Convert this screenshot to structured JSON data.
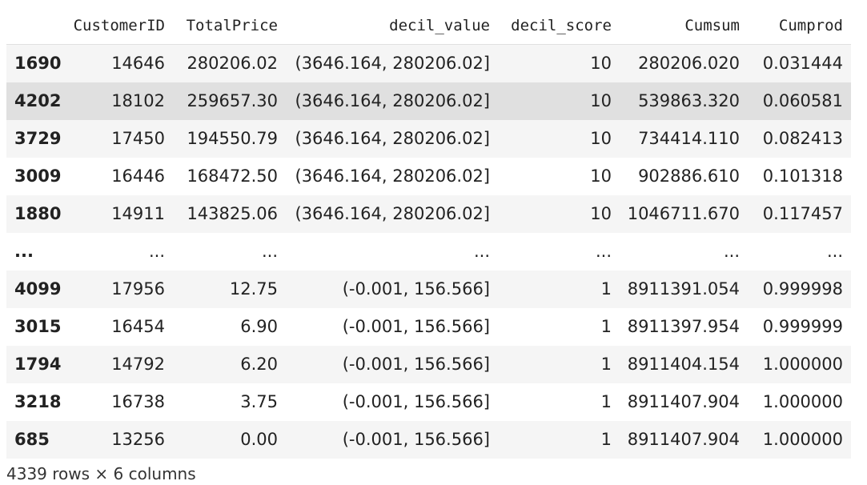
{
  "table": {
    "columns": [
      "CustomerID",
      "TotalPrice",
      "decil_value",
      "decil_score",
      "Cumsum",
      "Cumprod"
    ],
    "rows": [
      {
        "index": "1690",
        "cells": [
          "14646",
          "280206.02",
          "(3646.164, 280206.02]",
          "10",
          "280206.020",
          "0.031444"
        ]
      },
      {
        "index": "4202",
        "cells": [
          "18102",
          "259657.30",
          "(3646.164, 280206.02]",
          "10",
          "539863.320",
          "0.060581"
        ]
      },
      {
        "index": "3729",
        "cells": [
          "17450",
          "194550.79",
          "(3646.164, 280206.02]",
          "10",
          "734414.110",
          "0.082413"
        ]
      },
      {
        "index": "3009",
        "cells": [
          "16446",
          "168472.50",
          "(3646.164, 280206.02]",
          "10",
          "902886.610",
          "0.101318"
        ]
      },
      {
        "index": "1880",
        "cells": [
          "14911",
          "143825.06",
          "(3646.164, 280206.02]",
          "10",
          "1046711.670",
          "0.117457"
        ]
      },
      {
        "index": "...",
        "cells": [
          "...",
          "...",
          "...",
          "...",
          "...",
          "..."
        ]
      },
      {
        "index": "4099",
        "cells": [
          "17956",
          "12.75",
          "(-0.001, 156.566]",
          "1",
          "8911391.054",
          "0.999998"
        ]
      },
      {
        "index": "3015",
        "cells": [
          "16454",
          "6.90",
          "(-0.001, 156.566]",
          "1",
          "8911397.954",
          "0.999999"
        ]
      },
      {
        "index": "1794",
        "cells": [
          "14792",
          "6.20",
          "(-0.001, 156.566]",
          "1",
          "8911404.154",
          "1.000000"
        ]
      },
      {
        "index": "3218",
        "cells": [
          "16738",
          "3.75",
          "(-0.001, 156.566]",
          "1",
          "8911407.904",
          "1.000000"
        ]
      },
      {
        "index": "685",
        "cells": [
          "13256",
          "0.00",
          "(-0.001, 156.566]",
          "1",
          "8911407.904",
          "1.000000"
        ]
      }
    ]
  },
  "footer": "4339 rows × 6 columns"
}
